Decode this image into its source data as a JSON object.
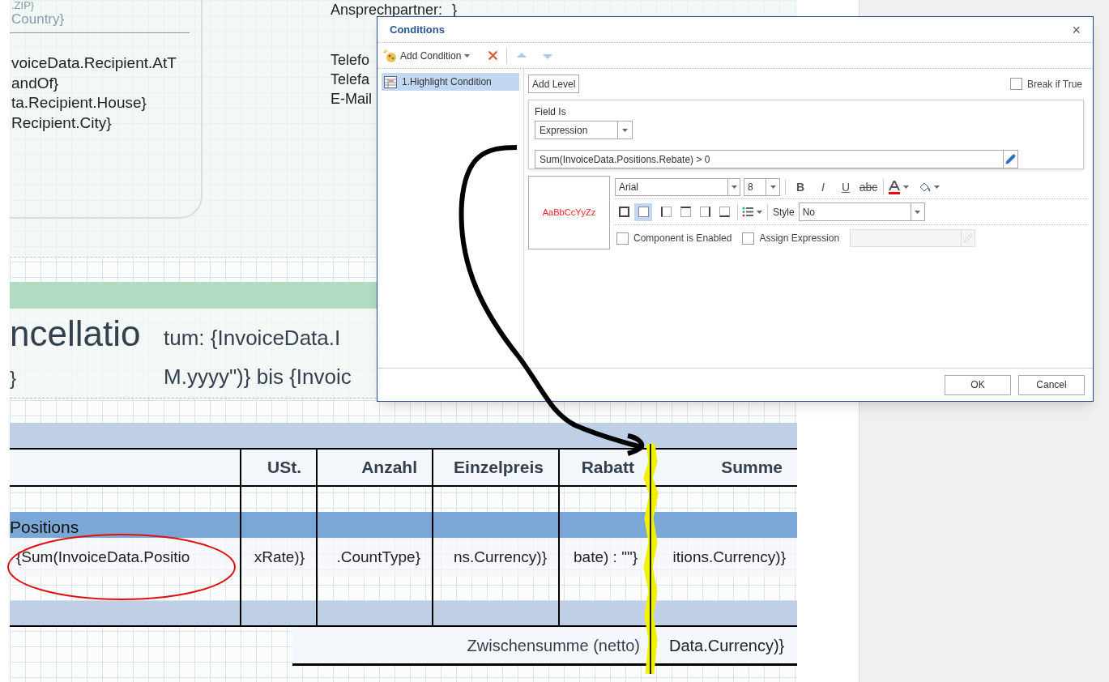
{
  "report": {
    "recipient_fields": [
      ".ZIP}",
      "Country}"
    ],
    "recipient_lines": [
      "voiceData.Recipient.AtT",
      "andOf}",
      "ta.Recipient.House}",
      "Recipient.City}"
    ],
    "contact": {
      "label": "Ansprechpartner:",
      "value": "}"
    },
    "contact_labels": [
      "Telefo",
      "Telefa",
      "E-Mail"
    ],
    "title": "ncellatio",
    "title_side": "}",
    "date_lines": [
      "tum: {InvoiceData.I",
      "M.yyyy\")} bis {Invoic"
    ],
    "table": {
      "columns": [
        "USt.",
        "Anzahl",
        "Einzelpreis",
        "Rabatt",
        "Summe"
      ],
      "group_header": "Positions",
      "row": [
        "{Sum(InvoiceData.Positio",
        "xRate)}",
        ".CountType}",
        "ns.Currency)}",
        "bate) : \"\"}",
        "itions.Currency)}"
      ],
      "subtotal": {
        "label": "Zwischensumme (netto)",
        "value": "Data.Currency)}"
      }
    }
  },
  "dialog": {
    "title": "Conditions",
    "close": "×",
    "toolbar": {
      "add": "Add Condition"
    },
    "conditions": [
      {
        "label": "1.Highlight Condition",
        "selected": true
      }
    ],
    "add_level": "Add Level",
    "break_if_true": {
      "label": "Break if True",
      "checked": false
    },
    "field_is": {
      "label": "Field Is",
      "type": "Expression",
      "expression": "Sum(InvoiceData.Positions.Rebate) > 0"
    },
    "preview": "AaBbCcYyZz",
    "font": "Arial",
    "size": "8",
    "format": [
      {
        "kind": "bold",
        "label": "B"
      },
      {
        "kind": "italic",
        "label": "I"
      },
      {
        "kind": "underline",
        "label": "U"
      },
      {
        "kind": "strike",
        "label": "abc"
      }
    ],
    "borders": [
      {
        "kind": "all",
        "selected": false
      },
      {
        "kind": "none",
        "selected": true
      },
      {
        "kind": "left",
        "selected": false
      },
      {
        "kind": "top",
        "selected": false
      },
      {
        "kind": "right",
        "selected": false
      },
      {
        "kind": "bottom",
        "selected": false
      }
    ],
    "style": {
      "label": "Style",
      "value": "No"
    },
    "component_enabled": {
      "label": "Component is Enabled",
      "checked": false
    },
    "assign_expression": {
      "label": "Assign Expression",
      "checked": false
    },
    "buttons": [
      "OK",
      "Cancel"
    ]
  }
}
